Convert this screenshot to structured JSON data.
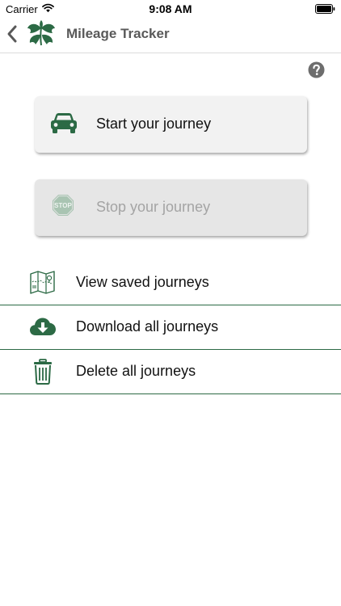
{
  "status_bar": {
    "carrier": "Carrier",
    "time": "9:08 AM"
  },
  "nav": {
    "title": "Mileage Tracker"
  },
  "actions": {
    "start_label": "Start your journey",
    "stop_label": "Stop your journey"
  },
  "menu": {
    "items": [
      {
        "label": "View saved journeys",
        "icon": "map-icon"
      },
      {
        "label": "Download all journeys",
        "icon": "cloud-download-icon"
      },
      {
        "label": "Delete all journeys",
        "icon": "trash-icon"
      }
    ]
  },
  "colors": {
    "brand_green": "#2c6a45",
    "title_gray": "#595959",
    "disabled_text": "#a4a4a4"
  }
}
